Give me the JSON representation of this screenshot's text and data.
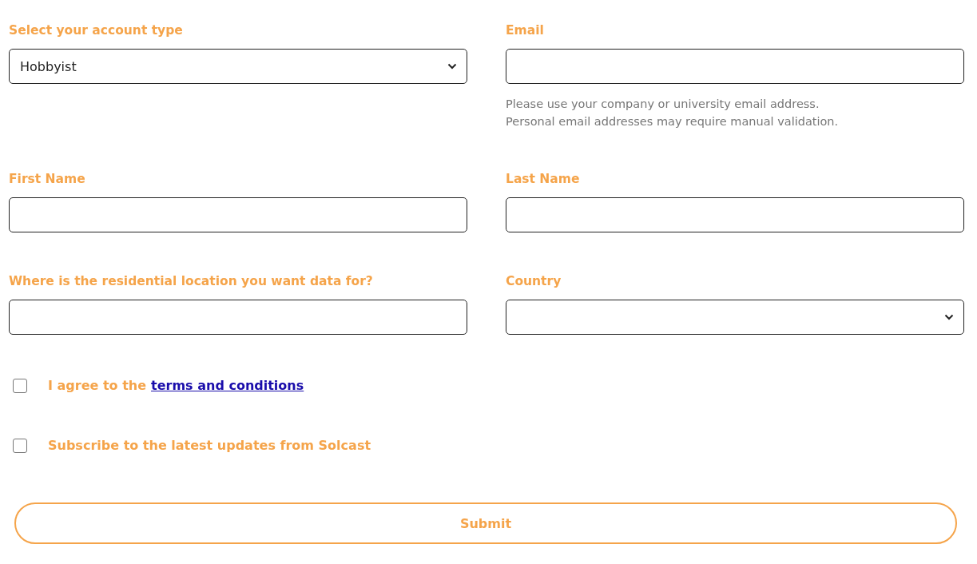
{
  "fields": [
    {
      "kind": "select",
      "label": "Select your account type",
      "value": "Hobbyist"
    },
    {
      "kind": "text",
      "label": "Email",
      "hint": "Please use your company or university email address.\nPersonal email addresses may require manual validation."
    },
    {
      "kind": "text",
      "label": "First Name"
    },
    {
      "kind": "text",
      "label": "Last Name"
    },
    {
      "kind": "text",
      "label": "Where is the residential location you want data for?"
    },
    {
      "kind": "select",
      "label": "Country"
    }
  ],
  "checkboxes": [
    {
      "text": "I agree to the",
      "link": "terms and conditions",
      "checked": false
    },
    {
      "text": "Subscribe to the latest updates from Solcast",
      "checked": false
    }
  ],
  "submit": "Submit"
}
